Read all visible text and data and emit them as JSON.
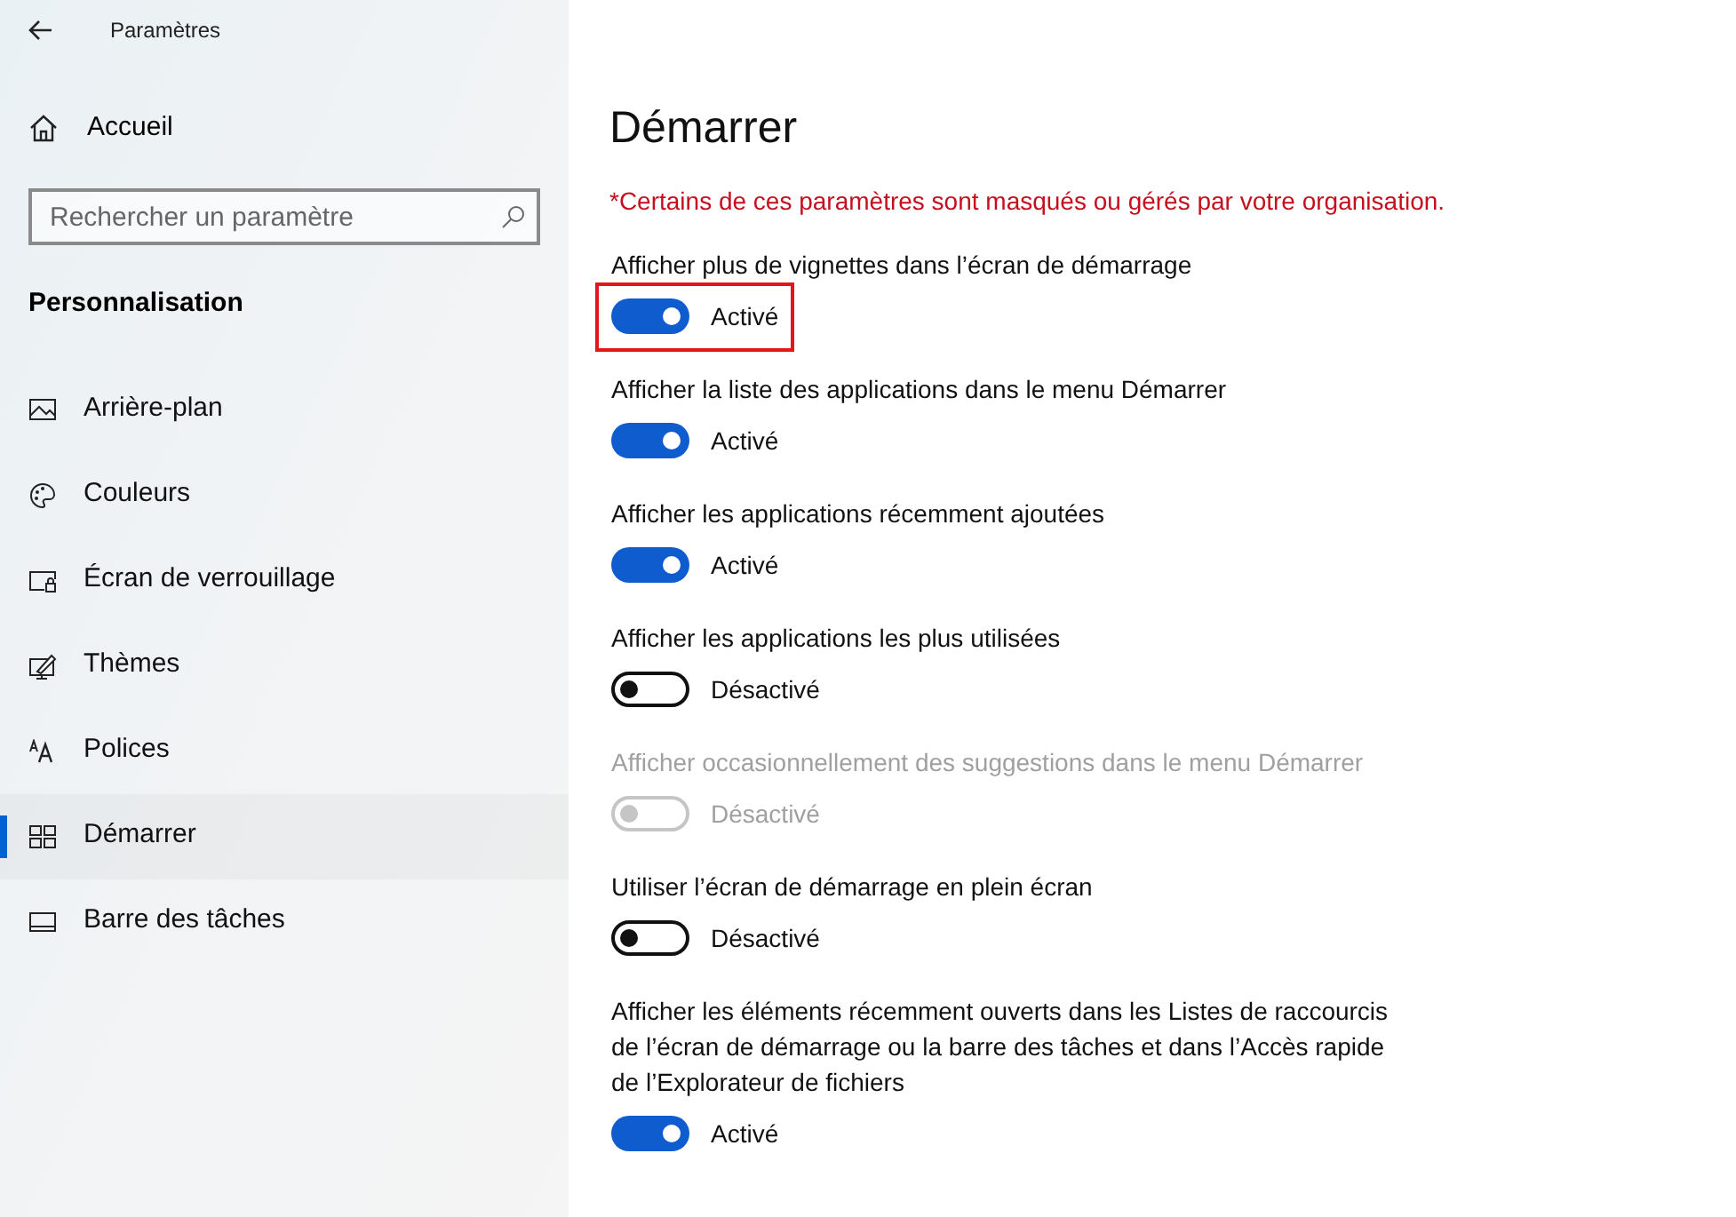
{
  "window": {
    "title": "Paramètres"
  },
  "sidebar": {
    "home": "Accueil",
    "search": {
      "placeholder": "Rechercher un paramètre"
    },
    "section": "Personnalisation",
    "items": [
      {
        "label": "Arrière-plan",
        "kind": "picture",
        "selected": false
      },
      {
        "label": "Couleurs",
        "kind": "palette",
        "selected": false
      },
      {
        "label": "Écran de verrouillage",
        "kind": "lock",
        "selected": false
      },
      {
        "label": "Thèmes",
        "kind": "theme",
        "selected": false
      },
      {
        "label": "Polices",
        "kind": "font",
        "selected": false
      },
      {
        "label": "Démarrer",
        "kind": "start",
        "selected": true
      },
      {
        "label": "Barre des tâches",
        "kind": "taskbar",
        "selected": false
      }
    ]
  },
  "page": {
    "title": "Démarrer",
    "notice": "*Certains de ces paramètres sont masqués ou gérés par votre organisation.",
    "settings": [
      {
        "label": "Afficher plus de vignettes dans l’écran de démarrage",
        "on": true,
        "disabled": false,
        "highlighted": true,
        "state_text": "Activé"
      },
      {
        "label": "Afficher la liste des applications dans le menu Démarrer",
        "on": true,
        "disabled": false,
        "highlighted": false,
        "state_text": "Activé"
      },
      {
        "label": "Afficher les applications récemment ajoutées",
        "on": true,
        "disabled": false,
        "highlighted": false,
        "state_text": "Activé"
      },
      {
        "label": "Afficher les applications les plus utilisées",
        "on": false,
        "disabled": false,
        "highlighted": false,
        "state_text": "Désactivé"
      },
      {
        "label": "Afficher occasionnellement des suggestions dans le menu Démarrer",
        "on": false,
        "disabled": true,
        "highlighted": false,
        "state_text": "Désactivé"
      },
      {
        "label": "Utiliser l’écran de démarrage en plein écran",
        "on": false,
        "disabled": false,
        "highlighted": false,
        "state_text": "Désactivé"
      },
      {
        "label": "Afficher les éléments récemment ouverts dans les Listes de raccourcis de l’écran de démarrage ou la barre des tâches et dans l’Accès rapide de l’Explorateur de fichiers",
        "on": true,
        "disabled": false,
        "highlighted": false,
        "state_text": "Activé"
      }
    ]
  }
}
